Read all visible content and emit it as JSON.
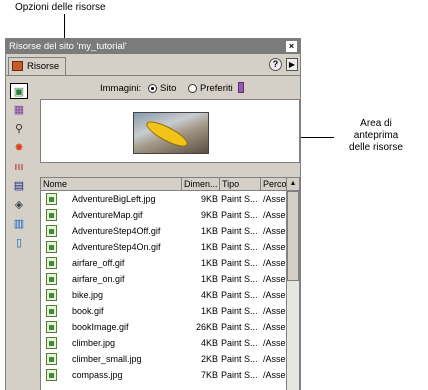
{
  "annotations": {
    "options_label": "Opzioni delle risorse",
    "preview_label_lines": [
      "Area di",
      "anteprima",
      "delle risorse"
    ]
  },
  "panel": {
    "title": "Risorse del sito 'my_tutorial'",
    "close_glyph": "×",
    "tab_label": "Risorse",
    "help_glyph": "?",
    "menu_glyph": "▶"
  },
  "sidebar": {
    "icons": [
      {
        "name": "images-icon",
        "glyph": "▣",
        "color": "#2e7d32",
        "active": true
      },
      {
        "name": "colors-icon",
        "glyph": "▦",
        "color": "#7b3f9a"
      },
      {
        "name": "urls-icon",
        "glyph": "⚲",
        "color": "#333333"
      },
      {
        "name": "flash-icon",
        "glyph": "✸",
        "color": "#d84315"
      },
      {
        "name": "shockwave-icon",
        "glyph": "ııı",
        "color": "#b71c1c"
      },
      {
        "name": "movies-icon",
        "glyph": "▤",
        "color": "#1a237e"
      },
      {
        "name": "scripts-icon",
        "glyph": "◈",
        "color": "#37474f"
      },
      {
        "name": "templates-icon",
        "glyph": "▥",
        "color": "#1565c0"
      },
      {
        "name": "library-icon",
        "glyph": "▯",
        "color": "#1565c0"
      }
    ]
  },
  "images_row": {
    "label": "Immagini:",
    "option_site": "Sito",
    "option_favorites": "Preferiti"
  },
  "list": {
    "columns": [
      "Nome",
      "Dimen...",
      "Tipo",
      "Perco"
    ],
    "scroll_up_glyph": "▲",
    "rows": [
      {
        "name": "AdventureBigLeft.jpg",
        "size": "9KB",
        "type": "Paint S...",
        "path": "/Asse"
      },
      {
        "name": "AdventureMap.gif",
        "size": "9KB",
        "type": "Paint S...",
        "path": "/Asse"
      },
      {
        "name": "AdventureStep4Off.gif",
        "size": "1KB",
        "type": "Paint S...",
        "path": "/Asse"
      },
      {
        "name": "AdventureStep4On.gif",
        "size": "1KB",
        "type": "Paint S...",
        "path": "/Asse"
      },
      {
        "name": "airfare_off.gif",
        "size": "1KB",
        "type": "Paint S...",
        "path": "/Asse"
      },
      {
        "name": "airfare_on.gif",
        "size": "1KB",
        "type": "Paint S...",
        "path": "/Asse"
      },
      {
        "name": "bike.jpg",
        "size": "4KB",
        "type": "Paint S...",
        "path": "/Asse"
      },
      {
        "name": "book.gif",
        "size": "1KB",
        "type": "Paint S...",
        "path": "/Asse"
      },
      {
        "name": "bookImage.gif",
        "size": "26KB",
        "type": "Paint S...",
        "path": "/Asse"
      },
      {
        "name": "climber.jpg",
        "size": "4KB",
        "type": "Paint S...",
        "path": "/Asse"
      },
      {
        "name": "climber_small.jpg",
        "size": "2KB",
        "type": "Paint S...",
        "path": "/Asse"
      },
      {
        "name": "compass.jpg",
        "size": "7KB",
        "type": "Paint S...",
        "path": "/Asse"
      }
    ]
  }
}
